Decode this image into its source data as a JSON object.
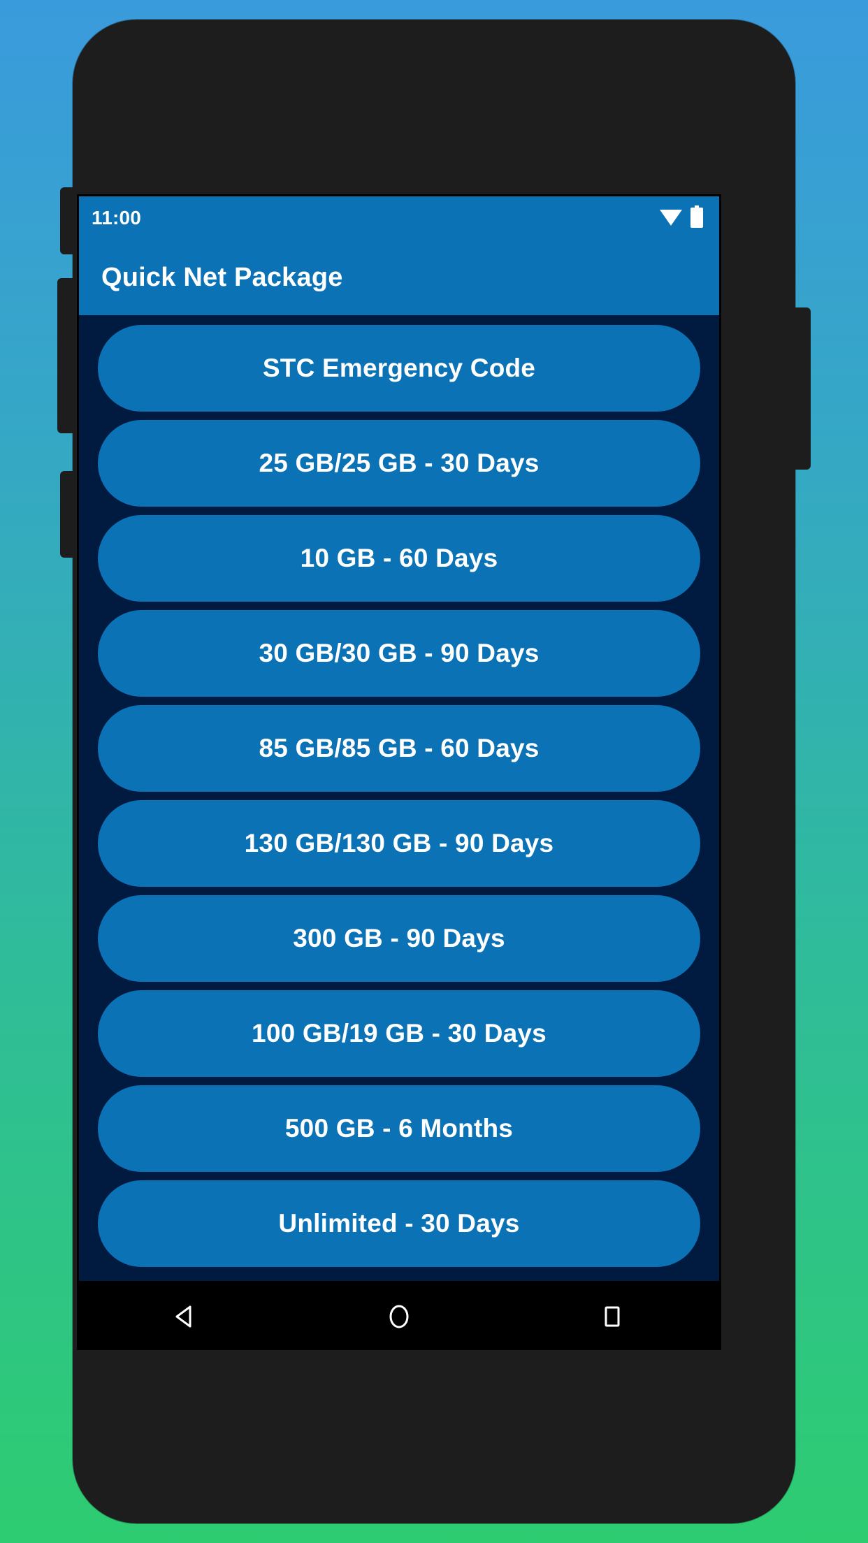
{
  "device": {
    "frame_color": "#1d1d1d",
    "background_gradient_from": "#3a9bdc",
    "background_gradient_to": "#2ecc71"
  },
  "status_bar": {
    "time": "11:00",
    "icons": [
      {
        "name": "wifi-icon",
        "label": "wifi"
      },
      {
        "name": "battery-icon",
        "label": "battery-full"
      }
    ],
    "background_color": "#0b72b5"
  },
  "app_bar": {
    "title": "Quick Net Package",
    "background_color": "#0b72b5",
    "text_color": "#ffffff"
  },
  "list": {
    "background_color": "#001a40",
    "button_color": "#0b72b5",
    "button_text_color": "#ffffff",
    "items": [
      {
        "label": "STC Emergency Code"
      },
      {
        "label": "25 GB/25 GB - 30 Days"
      },
      {
        "label": "10 GB - 60 Days"
      },
      {
        "label": "30 GB/30 GB - 90 Days"
      },
      {
        "label": "85 GB/85 GB - 60 Days"
      },
      {
        "label": "130 GB/130 GB - 90 Days"
      },
      {
        "label": "300 GB - 90 Days"
      },
      {
        "label": "100 GB/19 GB - 30 Days"
      },
      {
        "label": "500 GB - 6 Months"
      },
      {
        "label": "Unlimited - 30 Days"
      }
    ]
  },
  "nav_bar": {
    "background_color": "#000000",
    "buttons": [
      {
        "name": "back-button",
        "icon": "triangle-left-icon"
      },
      {
        "name": "home-button",
        "icon": "circle-icon"
      },
      {
        "name": "recents-button",
        "icon": "square-icon"
      }
    ]
  }
}
